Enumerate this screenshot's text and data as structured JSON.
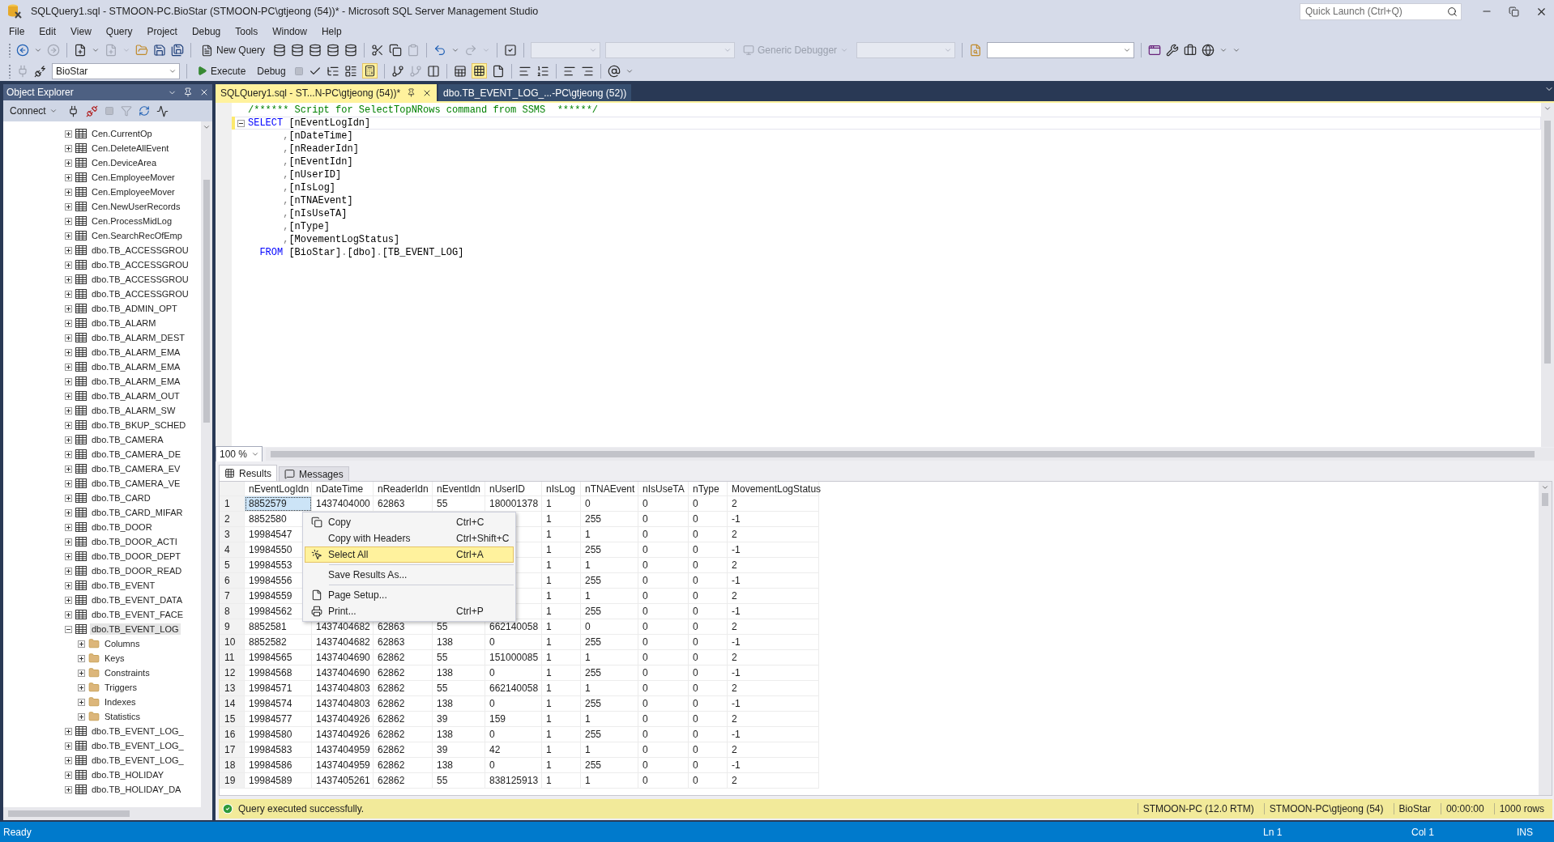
{
  "window": {
    "title": "SQLQuery1.sql - STMOON-PC.BioStar (STMOON-PC\\gtjeong (54))* - Microsoft SQL Server Management Studio",
    "quick_launch": {
      "placeholder": "Quick Launch (Ctrl+Q)"
    }
  },
  "menu": [
    "File",
    "Edit",
    "View",
    "Query",
    "Project",
    "Debug",
    "Tools",
    "Window",
    "Help"
  ],
  "toolbar": {
    "new_query": "New Query",
    "debugger": {
      "label": "Generic Debugger",
      "disabled": true
    },
    "database": "BioStar",
    "execute": "Execute",
    "debug": "Debug"
  },
  "object_explorer": {
    "title": "Object Explorer",
    "connect": "Connect",
    "items": [
      {
        "label": "Cen.CurrentOp",
        "expanded": false,
        "selected": false
      },
      {
        "label": "Cen.DeleteAllEvent",
        "expanded": false,
        "selected": false
      },
      {
        "label": "Cen.DeviceArea",
        "expanded": false,
        "selected": false
      },
      {
        "label": "Cen.EmployeeMover",
        "expanded": false,
        "selected": false
      },
      {
        "label": "Cen.EmployeeMover",
        "expanded": false,
        "selected": false
      },
      {
        "label": "Cen.NewUserRecords",
        "expanded": false,
        "selected": false
      },
      {
        "label": "Cen.ProcessMidLog",
        "expanded": false,
        "selected": false
      },
      {
        "label": "Cen.SearchRecOfEmp",
        "expanded": false,
        "selected": false
      },
      {
        "label": "dbo.TB_ACCESSGROU",
        "expanded": false,
        "selected": false
      },
      {
        "label": "dbo.TB_ACCESSGROU",
        "expanded": false,
        "selected": false
      },
      {
        "label": "dbo.TB_ACCESSGROU",
        "expanded": false,
        "selected": false
      },
      {
        "label": "dbo.TB_ACCESSGROU",
        "expanded": false,
        "selected": false
      },
      {
        "label": "dbo.TB_ADMIN_OPT",
        "expanded": false,
        "selected": false
      },
      {
        "label": "dbo.TB_ALARM",
        "expanded": false,
        "selected": false
      },
      {
        "label": "dbo.TB_ALARM_DEST",
        "expanded": false,
        "selected": false
      },
      {
        "label": "dbo.TB_ALARM_EMA",
        "expanded": false,
        "selected": false
      },
      {
        "label": "dbo.TB_ALARM_EMA",
        "expanded": false,
        "selected": false
      },
      {
        "label": "dbo.TB_ALARM_EMA",
        "expanded": false,
        "selected": false
      },
      {
        "label": "dbo.TB_ALARM_OUT",
        "expanded": false,
        "selected": false
      },
      {
        "label": "dbo.TB_ALARM_SW",
        "expanded": false,
        "selected": false
      },
      {
        "label": "dbo.TB_BKUP_SCHED",
        "expanded": false,
        "selected": false
      },
      {
        "label": "dbo.TB_CAMERA",
        "expanded": false,
        "selected": false
      },
      {
        "label": "dbo.TB_CAMERA_DE",
        "expanded": false,
        "selected": false
      },
      {
        "label": "dbo.TB_CAMERA_EV",
        "expanded": false,
        "selected": false
      },
      {
        "label": "dbo.TB_CAMERA_VE",
        "expanded": false,
        "selected": false
      },
      {
        "label": "dbo.TB_CARD",
        "expanded": false,
        "selected": false
      },
      {
        "label": "dbo.TB_CARD_MIFAR",
        "expanded": false,
        "selected": false
      },
      {
        "label": "dbo.TB_DOOR",
        "expanded": false,
        "selected": false
      },
      {
        "label": "dbo.TB_DOOR_ACTI",
        "expanded": false,
        "selected": false
      },
      {
        "label": "dbo.TB_DOOR_DEPT",
        "expanded": false,
        "selected": false
      },
      {
        "label": "dbo.TB_DOOR_READ",
        "expanded": false,
        "selected": false
      },
      {
        "label": "dbo.TB_EVENT",
        "expanded": false,
        "selected": false
      },
      {
        "label": "dbo.TB_EVENT_DATA",
        "expanded": false,
        "selected": false
      },
      {
        "label": "dbo.TB_EVENT_FACE",
        "expanded": false,
        "selected": false
      },
      {
        "label": "dbo.TB_EVENT_LOG",
        "expanded": true,
        "selected": true,
        "children": [
          {
            "label": "Columns",
            "expanded": false,
            "selected": false
          },
          {
            "label": "Keys",
            "expanded": false,
            "selected": false
          },
          {
            "label": "Constraints",
            "expanded": false,
            "selected": false
          },
          {
            "label": "Triggers",
            "expanded": false,
            "selected": false
          },
          {
            "label": "Indexes",
            "expanded": false,
            "selected": false
          },
          {
            "label": "Statistics",
            "expanded": false,
            "selected": false
          }
        ]
      },
      {
        "label": "dbo.TB_EVENT_LOG_",
        "expanded": false,
        "selected": false
      },
      {
        "label": "dbo.TB_EVENT_LOG_",
        "expanded": false,
        "selected": false
      },
      {
        "label": "dbo.TB_EVENT_LOG_",
        "expanded": false,
        "selected": false
      },
      {
        "label": "dbo.TB_HOLIDAY",
        "expanded": false,
        "selected": false
      },
      {
        "label": "dbo.TB_HOLIDAY_DA",
        "expanded": false,
        "selected": false
      }
    ]
  },
  "tabs": [
    {
      "label": "SQLQuery1.sql - ST...N-PC\\gtjeong (54))*",
      "selected": true
    },
    {
      "label": "dbo.TB_EVENT_LOG_...-PC\\gtjeong (52))",
      "selected": false
    }
  ],
  "editor": {
    "lines": [
      {
        "current": false,
        "foldable": false,
        "segments": [
          {
            "kind": "comment",
            "text": "/****** Script for SelectTopNRows command from SSMS  ******/"
          }
        ]
      },
      {
        "current": true,
        "foldable": true,
        "segments": [
          {
            "kind": "keyword",
            "text": "SELECT"
          },
          {
            "kind": "plain",
            "text": " [nEventLogIdn]"
          }
        ]
      },
      {
        "current": false,
        "foldable": false,
        "segments": [
          {
            "kind": "punct",
            "text": "      ,"
          },
          {
            "kind": "plain",
            "text": "[nDateTime]"
          }
        ]
      },
      {
        "current": false,
        "foldable": false,
        "segments": [
          {
            "kind": "punct",
            "text": "      ,"
          },
          {
            "kind": "plain",
            "text": "[nReaderIdn]"
          }
        ]
      },
      {
        "current": false,
        "foldable": false,
        "segments": [
          {
            "kind": "punct",
            "text": "      ,"
          },
          {
            "kind": "plain",
            "text": "[nEventIdn]"
          }
        ]
      },
      {
        "current": false,
        "foldable": false,
        "segments": [
          {
            "kind": "punct",
            "text": "      ,"
          },
          {
            "kind": "plain",
            "text": "[nUserID]"
          }
        ]
      },
      {
        "current": false,
        "foldable": false,
        "segments": [
          {
            "kind": "punct",
            "text": "      ,"
          },
          {
            "kind": "plain",
            "text": "[nIsLog]"
          }
        ]
      },
      {
        "current": false,
        "foldable": false,
        "segments": [
          {
            "kind": "punct",
            "text": "      ,"
          },
          {
            "kind": "plain",
            "text": "[nTNAEvent]"
          }
        ]
      },
      {
        "current": false,
        "foldable": false,
        "segments": [
          {
            "kind": "punct",
            "text": "      ,"
          },
          {
            "kind": "plain",
            "text": "[nIsUseTA]"
          }
        ]
      },
      {
        "current": false,
        "foldable": false,
        "segments": [
          {
            "kind": "punct",
            "text": "      ,"
          },
          {
            "kind": "plain",
            "text": "[nType]"
          }
        ]
      },
      {
        "current": false,
        "foldable": false,
        "segments": [
          {
            "kind": "punct",
            "text": "      ,"
          },
          {
            "kind": "plain",
            "text": "[MovementLogStatus]"
          }
        ]
      },
      {
        "current": false,
        "foldable": false,
        "segments": [
          {
            "kind": "keyword",
            "text": "  FROM"
          },
          {
            "kind": "plain",
            "text": " [BioStar]"
          },
          {
            "kind": "punct",
            "text": "."
          },
          {
            "kind": "plain",
            "text": "[dbo]"
          },
          {
            "kind": "punct",
            "text": "."
          },
          {
            "kind": "plain",
            "text": "[TB_EVENT_LOG]"
          }
        ]
      }
    ]
  },
  "zoom": "100 %",
  "results": {
    "tabs": [
      {
        "label": "Results",
        "selected": true
      },
      {
        "label": "Messages",
        "selected": false
      }
    ],
    "columns": [
      "nEventLogIdn",
      "nDateTime",
      "nReaderIdn",
      "nEventIdn",
      "nUserID",
      "nIsLog",
      "nTNAEvent",
      "nIsUseTA",
      "nType",
      "MovementLogStatus"
    ],
    "rows": [
      {
        "number": "1",
        "selected": true,
        "cells": [
          "8852579",
          "1437404000",
          "62863",
          "55",
          "180001378",
          "1",
          "0",
          "0",
          "0",
          "2"
        ]
      },
      {
        "number": "2",
        "selected": false,
        "cells": [
          "8852580",
          null,
          null,
          null,
          null,
          "1",
          "255",
          "0",
          "0",
          "-1"
        ]
      },
      {
        "number": "3",
        "selected": false,
        "cells": [
          "19984547",
          null,
          null,
          null,
          null,
          "1",
          "1",
          "0",
          "0",
          "2"
        ]
      },
      {
        "number": "4",
        "selected": false,
        "cells": [
          "19984550",
          null,
          null,
          null,
          null,
          "1",
          "255",
          "0",
          "0",
          "-1"
        ]
      },
      {
        "number": "5",
        "selected": false,
        "cells": [
          "19984553",
          null,
          null,
          null,
          null,
          "1",
          "1",
          "0",
          "0",
          "2"
        ]
      },
      {
        "number": "6",
        "selected": false,
        "cells": [
          "19984556",
          null,
          null,
          null,
          null,
          "1",
          "255",
          "0",
          "0",
          "-1"
        ]
      },
      {
        "number": "7",
        "selected": false,
        "cells": [
          "19984559",
          null,
          null,
          null,
          null,
          "1",
          "1",
          "0",
          "0",
          "2"
        ]
      },
      {
        "number": "8",
        "selected": false,
        "cells": [
          "19984562",
          null,
          null,
          null,
          null,
          "1",
          "255",
          "0",
          "0",
          "-1"
        ]
      },
      {
        "number": "9",
        "selected": false,
        "cells": [
          "8852581",
          "1437404682",
          "62863",
          "55",
          "662140058",
          "1",
          "0",
          "0",
          "0",
          "2"
        ]
      },
      {
        "number": "10",
        "selected": false,
        "cells": [
          "8852582",
          "1437404682",
          "62863",
          "138",
          "0",
          "1",
          "255",
          "0",
          "0",
          "-1"
        ]
      },
      {
        "number": "11",
        "selected": false,
        "cells": [
          "19984565",
          "1437404690",
          "62862",
          "55",
          "151000085",
          "1",
          "1",
          "0",
          "0",
          "2"
        ]
      },
      {
        "number": "12",
        "selected": false,
        "cells": [
          "19984568",
          "1437404690",
          "62862",
          "138",
          "0",
          "1",
          "255",
          "0",
          "0",
          "-1"
        ]
      },
      {
        "number": "13",
        "selected": false,
        "cells": [
          "19984571",
          "1437404803",
          "62862",
          "55",
          "662140058",
          "1",
          "1",
          "0",
          "0",
          "2"
        ]
      },
      {
        "number": "14",
        "selected": false,
        "cells": [
          "19984574",
          "1437404803",
          "62862",
          "138",
          "0",
          "1",
          "255",
          "0",
          "0",
          "-1"
        ]
      },
      {
        "number": "15",
        "selected": false,
        "cells": [
          "19984577",
          "1437404926",
          "62862",
          "39",
          "159",
          "1",
          "1",
          "0",
          "0",
          "2"
        ]
      },
      {
        "number": "16",
        "selected": false,
        "cells": [
          "19984580",
          "1437404926",
          "62862",
          "138",
          "0",
          "1",
          "255",
          "0",
          "0",
          "-1"
        ]
      },
      {
        "number": "17",
        "selected": false,
        "cells": [
          "19984583",
          "1437404959",
          "62862",
          "39",
          "42",
          "1",
          "1",
          "0",
          "0",
          "2"
        ]
      },
      {
        "number": "18",
        "selected": false,
        "cells": [
          "19984586",
          "1437404959",
          "62862",
          "138",
          "0",
          "1",
          "255",
          "0",
          "0",
          "-1"
        ]
      },
      {
        "number": "19",
        "selected": false,
        "cells": [
          "19984589",
          "1437405261",
          "62862",
          "55",
          "838125913",
          "1",
          "1",
          "0",
          "0",
          "2"
        ]
      }
    ]
  },
  "context_menu": [
    {
      "kind": "item",
      "label": "Copy",
      "shortcut": "Ctrl+C",
      "selected": false
    },
    {
      "kind": "item",
      "label": "Copy with Headers",
      "shortcut": "Ctrl+Shift+C",
      "selected": false
    },
    {
      "kind": "item",
      "label": "Select All",
      "shortcut": "Ctrl+A",
      "selected": true
    },
    {
      "kind": "separator"
    },
    {
      "kind": "item",
      "label": "Save Results As...",
      "selected": false
    },
    {
      "kind": "separator"
    },
    {
      "kind": "item",
      "label": "Page Setup...",
      "selected": false
    },
    {
      "kind": "item",
      "label": "Print...",
      "shortcut": "Ctrl+P",
      "selected": false
    }
  ],
  "query_status": {
    "message": "Query executed successfully.",
    "fields": [
      "STMOON-PC (12.0 RTM)",
      "STMOON-PC\\gtjeong (54)",
      "BioStar",
      "00:00:00",
      "1000 rows"
    ]
  },
  "status_bar": {
    "state": "Ready",
    "line": "Ln 1",
    "column": "Col 1",
    "mode": "INS"
  }
}
